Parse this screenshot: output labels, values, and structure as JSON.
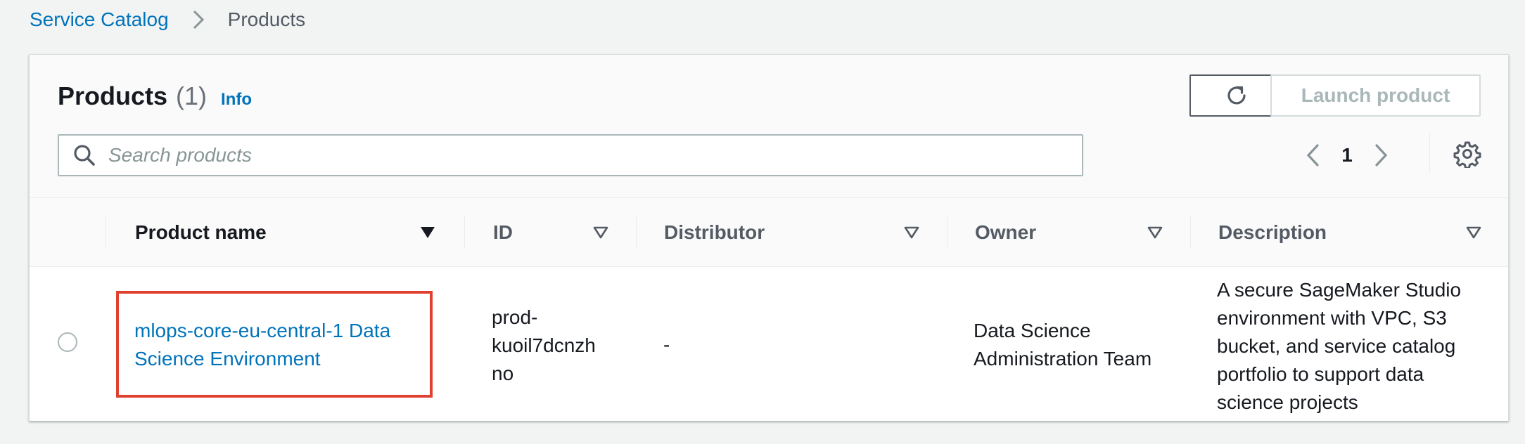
{
  "breadcrumb": {
    "parent": "Service Catalog",
    "current": "Products"
  },
  "header": {
    "title": "Products",
    "count": "(1)",
    "info": "Info",
    "launch_label": "Launch product"
  },
  "search": {
    "placeholder": "Search products",
    "value": ""
  },
  "pagination": {
    "page": "1"
  },
  "table": {
    "columns": [
      "Product name",
      "ID",
      "Distributor",
      "Owner",
      "Description"
    ],
    "rows": [
      {
        "name": "mlops-core-eu-central-1 Data Science Environment",
        "id": "prod-kuoil7dcnzhno",
        "id_display": [
          "prod-",
          "kuoil7dcnzh",
          "no"
        ],
        "distributor": "-",
        "owner": "Data Science Administration Team",
        "description": "A secure SageMaker Studio environment with VPC, S3 bucket, and service catalog portfolio to support data science projects",
        "selected": false
      }
    ]
  },
  "icons": {
    "breadcrumb_separator": "chevron-right-icon",
    "refresh": "refresh-icon",
    "search": "search-icon",
    "prev": "chevron-left-icon",
    "next": "chevron-right-icon",
    "settings": "gear-icon",
    "sort_active": "caret-down-filled-icon",
    "sort_inactive": "caret-down-outline-icon"
  },
  "colors": {
    "link": "#0073bb",
    "highlight": "#e0402f",
    "disabled": "#aab7b8",
    "background": "#f2f3f3"
  }
}
